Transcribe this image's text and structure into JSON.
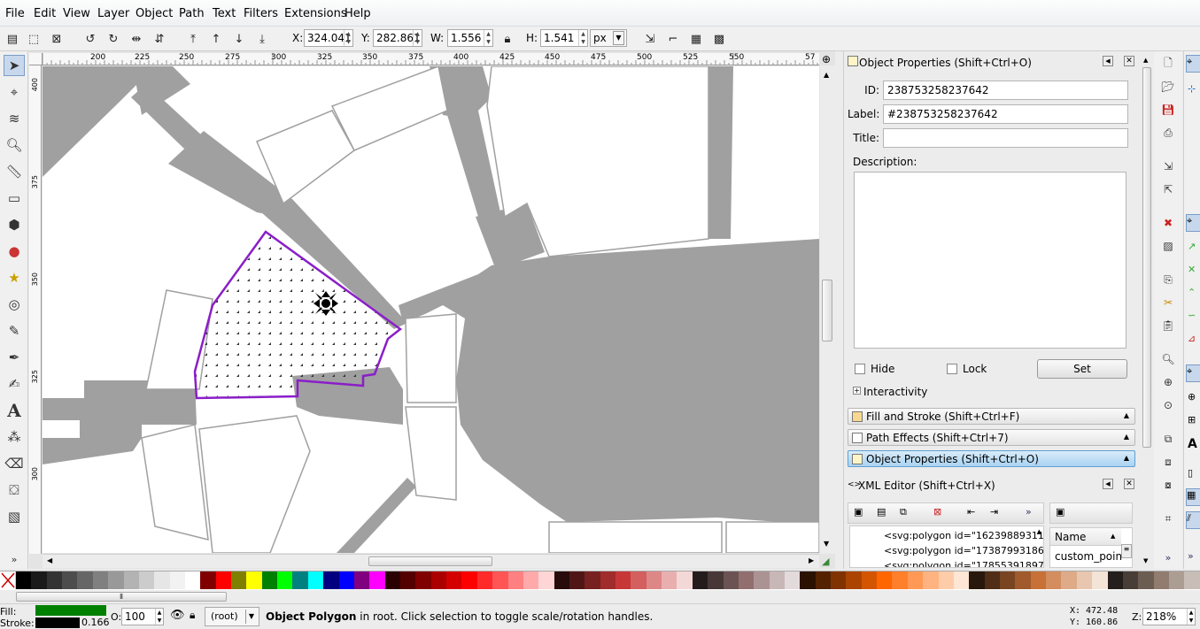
{
  "menu": [
    "File",
    "Edit",
    "View",
    "Layer",
    "Object",
    "Path",
    "Text",
    "Filters",
    "Extensions",
    "Help"
  ],
  "toolctl": {
    "x_label": "X:",
    "x_value": "324.041",
    "y_label": "Y:",
    "y_value": "282.861",
    "w_label": "W:",
    "w_value": "1.556",
    "h_label": "H:",
    "h_value": "1.541",
    "unit": "px"
  },
  "ruler": {
    "h_ticks": [
      "200",
      "225",
      "250",
      "275",
      "300",
      "325",
      "350",
      "375",
      "400",
      "425",
      "450",
      "475",
      "500",
      "525",
      "550",
      "57"
    ],
    "v_ticks": [
      "400",
      "375",
      "350",
      "325",
      "300"
    ]
  },
  "objprops": {
    "title": "Object Properties (Shift+Ctrl+O)",
    "id_label": "ID:",
    "id_value": "238753258237642",
    "label_label": "Label:",
    "label_value": "#238753258237642",
    "title_label": "Title:",
    "title_value": "",
    "desc_label": "Description:",
    "hide_label": "Hide",
    "lock_label": "Lock",
    "set_label": "Set",
    "interactivity_label": "Interactivity"
  },
  "expanders": {
    "fill_stroke": "Fill and Stroke (Shift+Ctrl+F)",
    "path_effects": "Path Effects  (Shift+Ctrl+7)",
    "object_props": "Object Properties (Shift+Ctrl+O)"
  },
  "xml": {
    "title": "XML Editor (Shift+Ctrl+X)",
    "nodes": [
      "<svg:polygon id=\"16239889311",
      "<svg:polygon id=\"17387993186",
      "<svg:polygon id=\"17855391897"
    ],
    "attr_header": "Name",
    "attr_value": "custom_poin"
  },
  "status": {
    "fill_label": "Fill:",
    "stroke_label": "Stroke:",
    "stroke_width": "0.166",
    "opacity_label": "O:",
    "opacity_value": "100",
    "layer": "(root)",
    "message_bold": "Object Polygon",
    "message_rest": " in root. Click selection to toggle scale/rotation handles.",
    "x_label": "X:",
    "x_value": "472.48",
    "y_label": "Y:",
    "y_value": "160.86",
    "z_label": "Z:",
    "zoom": "218%"
  },
  "colors": {
    "fill": "#008000",
    "stroke": "#000000",
    "selection": "#8a1ec8",
    "shape": "#a0a0a0",
    "palette": [
      "#000000",
      "#1a1a1a",
      "#333333",
      "#4d4d4d",
      "#666666",
      "#808080",
      "#999999",
      "#b3b3b3",
      "#cccccc",
      "#e6e6e6",
      "#f2f2f2",
      "#ffffff",
      "#800000",
      "#ff0000",
      "#808000",
      "#ffff00",
      "#008000",
      "#00ff00",
      "#008080",
      "#00ffff",
      "#000080",
      "#0000ff",
      "#800080",
      "#ff00ff",
      "#2b0000",
      "#550000",
      "#800000",
      "#aa0000",
      "#d40000",
      "#ff0000",
      "#ff2a2a",
      "#ff5555",
      "#ff8080",
      "#ffaaaa",
      "#ffd5d5",
      "#280b0b",
      "#501616",
      "#782121",
      "#a02c2c",
      "#c83737",
      "#d35f5f",
      "#de8787",
      "#e9afaf",
      "#f4d7d7",
      "#241c1c",
      "#483737",
      "#6c5353",
      "#916f6f",
      "#ac9393",
      "#c8b7b7",
      "#e3dbdb",
      "#2b1100",
      "#552200",
      "#803300",
      "#aa4400",
      "#d45500",
      "#ff6600",
      "#ff7f2a",
      "#ff9955",
      "#ffb380",
      "#ffccaa",
      "#ffe6d5",
      "#28170b",
      "#502d16",
      "#784421",
      "#a05a2c",
      "#c87137",
      "#d38d5f",
      "#deaa87",
      "#e9c6af",
      "#f4e3d7",
      "#241f1c",
      "#483e37",
      "#6c5d53",
      "#917c6f",
      "#ac9d93",
      "#c8beb7"
    ]
  }
}
